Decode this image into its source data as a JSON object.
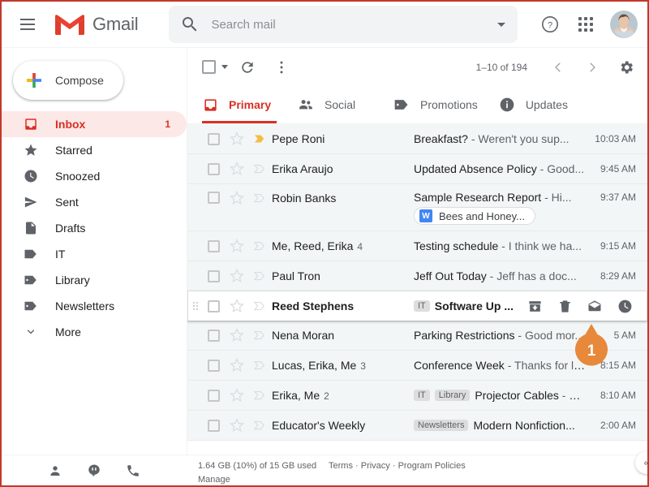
{
  "app": {
    "brand": "Gmail",
    "logo_colors": {
      "red": "#ea4335",
      "white": "#ffffff"
    },
    "accent": "#d93025"
  },
  "topbar": {
    "menu_label": "Main menu",
    "search": {
      "placeholder": "Search mail",
      "value": ""
    },
    "search_options_label": "Show search options",
    "help_label": "Support",
    "apps_label": "Google apps",
    "account_label": "Google Account"
  },
  "sidebar": {
    "compose_label": "Compose",
    "items": [
      {
        "label": "Inbox",
        "icon": "inbox-icon",
        "count": "1",
        "active": true
      },
      {
        "label": "Starred",
        "icon": "star-icon",
        "count": "",
        "active": false
      },
      {
        "label": "Snoozed",
        "icon": "clock-icon",
        "count": "",
        "active": false
      },
      {
        "label": "Sent",
        "icon": "send-icon",
        "count": "",
        "active": false
      },
      {
        "label": "Drafts",
        "icon": "draft-icon",
        "count": "",
        "active": false
      },
      {
        "label": "IT",
        "icon": "label-icon",
        "count": "",
        "active": false
      },
      {
        "label": "Library",
        "icon": "label-icon",
        "count": "",
        "active": false
      },
      {
        "label": "Newsletters",
        "icon": "label-icon",
        "count": "",
        "active": false
      },
      {
        "label": "More",
        "icon": "chevron-down-icon",
        "count": "",
        "active": false
      }
    ]
  },
  "toolbar": {
    "select_all_label": "Select",
    "refresh_label": "Refresh",
    "more_label": "More",
    "page_count": "1–10 of 194",
    "prev_label": "Older",
    "next_label": "Newer",
    "settings_label": "Settings"
  },
  "tabs": [
    {
      "label": "Primary",
      "icon": "inbox-icon",
      "active": true
    },
    {
      "label": "Social",
      "icon": "people-icon",
      "active": false
    },
    {
      "label": "Promotions",
      "icon": "tag-icon",
      "active": false
    },
    {
      "label": "Updates",
      "icon": "info-icon",
      "active": false
    }
  ],
  "emails": [
    {
      "sender": "Pepe Roni",
      "count": "",
      "labels": [],
      "subject": "Breakfast?",
      "separator": " - ",
      "snippet": "Weren't you sup...",
      "time": "10:03 AM",
      "unread": false,
      "important": true,
      "attachment": null,
      "hovered": false
    },
    {
      "sender": "Erika Araujo",
      "count": "",
      "labels": [],
      "subject": "Updated Absence Policy",
      "separator": " - ",
      "snippet": "Good...",
      "time": "9:45 AM",
      "unread": false,
      "important": false,
      "attachment": null,
      "hovered": false
    },
    {
      "sender": "Robin Banks",
      "count": "",
      "labels": [],
      "subject": "Sample Research Report",
      "separator": " - ",
      "snippet": "Hi...",
      "time": "9:37 AM",
      "unread": false,
      "important": false,
      "attachment": {
        "name": "Bees and Honey...",
        "icon": "word-doc-icon",
        "icon_letter": "W"
      },
      "hovered": false
    },
    {
      "sender": "Me, Reed, Erika",
      "count": "4",
      "labels": [],
      "subject": "Testing schedule",
      "separator": " - ",
      "snippet": "I think we ha...",
      "time": "9:15 AM",
      "unread": false,
      "important": false,
      "attachment": null,
      "hovered": false
    },
    {
      "sender": "Paul Tron",
      "count": "",
      "labels": [],
      "subject": "Jeff Out Today",
      "separator": " - ",
      "snippet": "Jeff has a doc...",
      "time": "8:29 AM",
      "unread": false,
      "important": false,
      "attachment": null,
      "hovered": false
    },
    {
      "sender": "Reed Stephens",
      "count": "",
      "labels": [
        "IT"
      ],
      "subject": "Software Up ...",
      "separator": "",
      "snippet": "",
      "time": "",
      "unread": true,
      "important": false,
      "attachment": null,
      "hovered": true
    },
    {
      "sender": "Nena Moran",
      "count": "",
      "labels": [],
      "subject": "Parking Restrictions",
      "separator": " - ",
      "snippet": "Good mor...",
      "time": "5 AM",
      "unread": false,
      "important": false,
      "attachment": null,
      "hovered": false
    },
    {
      "sender": "Lucas, Erika, Me",
      "count": "3",
      "labels": [],
      "subject": "Conference Week",
      "separator": " - ",
      "snippet": "Thanks for le...",
      "time": "8:15 AM",
      "unread": false,
      "important": false,
      "attachment": null,
      "hovered": false
    },
    {
      "sender": "Erika, Me",
      "count": "2",
      "labels": [
        "IT",
        "Library"
      ],
      "subject": "Projector Cables",
      "separator": " - ",
      "snippet": "M...",
      "time": "8:10 AM",
      "unread": false,
      "important": false,
      "attachment": null,
      "hovered": false
    },
    {
      "sender": "Educator's Weekly",
      "count": "",
      "labels": [
        "Newsletters"
      ],
      "subject": "Modern Nonfiction...",
      "separator": "",
      "snippet": "",
      "time": "2:00 AM",
      "unread": false,
      "important": false,
      "attachment": null,
      "hovered": false
    }
  ],
  "row_actions": [
    {
      "name": "archive-icon",
      "label": "Archive"
    },
    {
      "name": "delete-icon",
      "label": "Delete"
    },
    {
      "name": "mark-as-read-icon",
      "label": "Mark as read"
    },
    {
      "name": "snooze-icon",
      "label": "Snooze"
    }
  ],
  "callout": {
    "number": "1",
    "color": "#e8883a"
  },
  "footer": {
    "storage": "1.64 GB (10%) of 15 GB used",
    "manage": "Manage",
    "terms": "Terms",
    "dot1": " · ",
    "privacy": "Privacy",
    "dot2": " · ",
    "policies": "Program Policies",
    "icons": [
      {
        "name": "contacts-icon",
        "label": "Contacts"
      },
      {
        "name": "hangouts-icon",
        "label": "Hangouts"
      },
      {
        "name": "phone-icon",
        "label": "Phone"
      }
    ],
    "collapse_label": "«"
  }
}
